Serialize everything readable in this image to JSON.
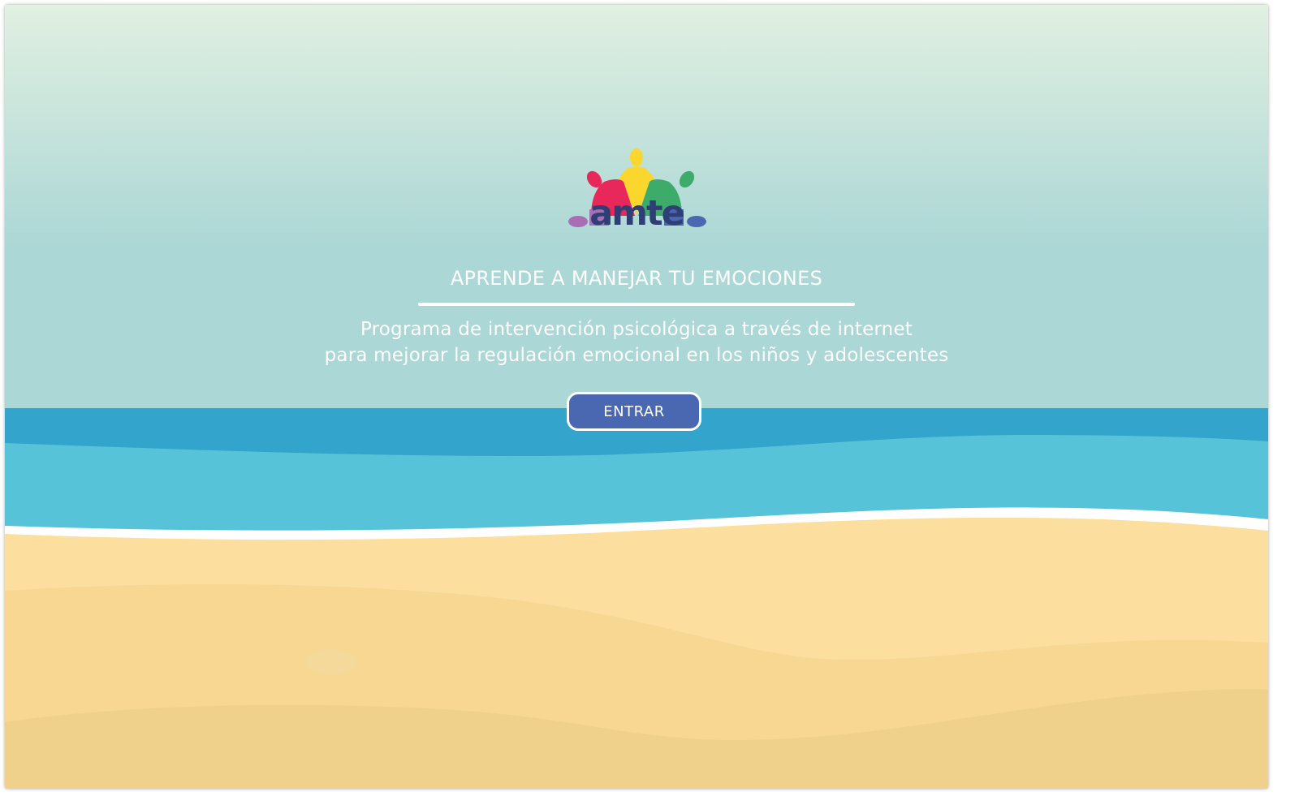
{
  "logo": {
    "word": "amte",
    "colors": {
      "red": "#e8285a",
      "yellow": "#fbd62d",
      "green": "#3dab6a",
      "purple": "#a86fb4",
      "blue": "#4a67b1",
      "text": "#2f3e74"
    }
  },
  "hero": {
    "headline": "APRENDE A MANEJAR TU EMOCIONES",
    "subtitle_line1": "Programa de intervención psicológica a través de internet",
    "subtitle_line2": "para mejorar la regulación emocional en los niños y adolescentes",
    "enter_label": "ENTRAR"
  },
  "scene_colors": {
    "sky_top": "#e1f0e1",
    "sky_bottom": "#abd7d6",
    "sea_deep": "#33a4cb",
    "sea_shallow": "#56c3d9",
    "foam": "#ffffff",
    "sand_light": "#fcdf9f",
    "sand_mid": "#f7d792",
    "sand_dark": "#efd18c",
    "button": "#4a67b1"
  }
}
